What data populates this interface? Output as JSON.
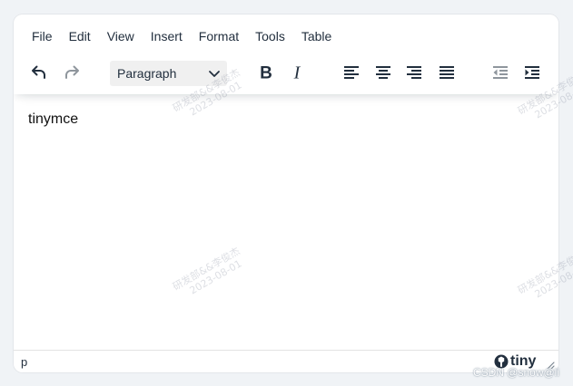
{
  "menubar": {
    "items": [
      "File",
      "Edit",
      "View",
      "Insert",
      "Format",
      "Tools",
      "Table"
    ]
  },
  "toolbar": {
    "block_format": "Paragraph",
    "buttons": [
      "undo-icon",
      "redo-icon",
      "bold-icon",
      "italic-icon",
      "align-left-icon",
      "align-center-icon",
      "align-right-icon",
      "align-justify-icon",
      "outdent-icon",
      "indent-icon"
    ]
  },
  "content": {
    "text": "tinymce"
  },
  "statusbar": {
    "path": "p",
    "logo": "tiny"
  },
  "watermark": {
    "line1": "研发部&&李俊杰",
    "line2": "2023-08-01"
  },
  "credit": "CSDN @snow@li",
  "colors": {
    "text": "#222f3e",
    "background": "#f0f3f6",
    "select_bg": "#f0f0f0"
  }
}
